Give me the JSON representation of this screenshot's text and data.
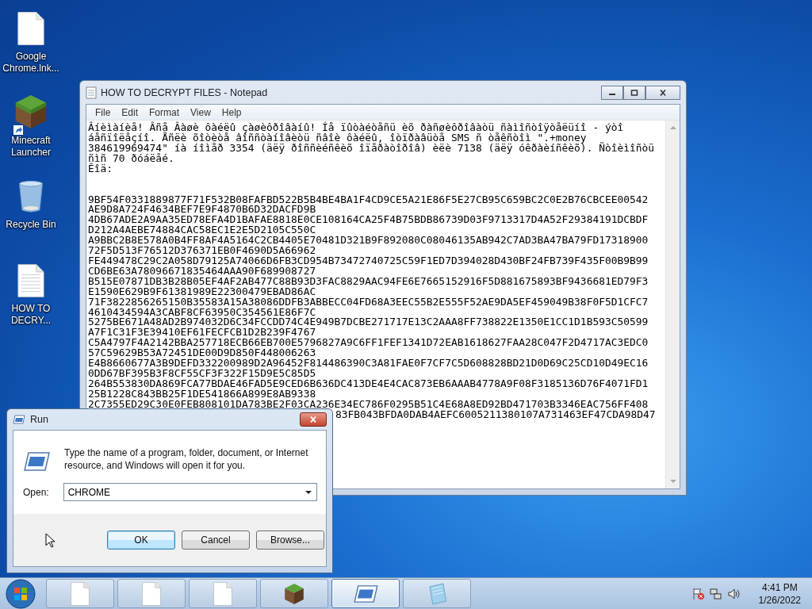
{
  "desktop": {
    "icons": [
      {
        "label": "Google Chrome.lnk...",
        "kind": "document",
        "shortcut": false
      },
      {
        "label": "Minecraft Launcher",
        "kind": "grass-block",
        "shortcut": true
      },
      {
        "label": "Recycle Bin",
        "kind": "recycle-bin",
        "shortcut": false
      },
      {
        "label": "HOW TO DECRY...",
        "kind": "text-document",
        "shortcut": false
      }
    ]
  },
  "notepad": {
    "title": "HOW TO DECRYPT FILES - Notepad",
    "menu": [
      "File",
      "Edit",
      "Format",
      "View",
      "Help"
    ],
    "message_lines": [
      "Âíèìàíèå! Âñå Âàøè ôàéëû çàøèôðîâàíû! Íå ïûòàéòåñü èõ ðàñøèôðîâàòü ñàìîñòîÿòåëüíî - ýòî",
      "áåñïîëåçíî. Åñëè õîòèòå âîññòàíîâèòü ñâîè ôàéëû, îòïðàâüòå SMS ñ òåêñòîì \".+money",
      "384619969474\" íà íîìåð 3354 (äëÿ ðîññèéñêèõ îïåðàòîðîâ) èëè 7138 (äëÿ óêðàèíñêèõ). Ñòîèìîñòü",
      "ñìñ 70 ðóáëåé.",
      "Êîä:"
    ],
    "code_lines": [
      "9BF54F0331889877F71F532B08FAFBD522B5B4BE4BA1F4CD9CE5A21E86F5E27CB95C659BC2C0E2B76CBCEE00542",
      "AE9D8A724F4634BEF7E9F4870B6D32DACFD9B",
      "4DB67ADE2A9AA35ED78EFA4D1BAFAE8818E0CE108164CA25F4B75BDB86739D03F9713317D4A52F29384191DCBDF",
      "D212A4AEBE74884CAC58EC1E2E5D2105C550C",
      "A9BBC2B8E578A0B4FF8AF4A5164C2CB4405E70481D321B9F892080C08046135AB942C7AD3BA47BA79FD17318900",
      "72F5D513F76512D376371EB0F4690D5A66962",
      "FE449478C29C2A058D79125A74066D6FB3CD954B73472740725C59F1ED7D394028D430BF24FB739F435F00B9B99",
      "CD6BE63A78096671835464AAA90F689908727",
      "B515E07871DB3B28B05EF4AF2AB477C88B93D3FAC8829AAC94FE6E7665152916F5D881675893BF9436681ED79F3",
      "E1590E629B9F61381989E22300479EBAD86AC",
      "71F3822856265150B35583A15A38086DDFB3ABBECC04FD68A3EEC55B2E555F52AE9DA5EF459049B38F0F5D1CFC7",
      "4610434594A3CABF8CF63950C354561E86F7C",
      "5275BE671A48AD2B974032D6C34FCCDD74C4E949B7DCBE271717E13C2AAA8FF738822E1350E1CC1D1B593C50599",
      "A7F1C31F3E39410EF61FECFCB1D2B239F4767",
      "C5A4797F4A2142BBA257718ECB66EB700E5796827A9C6FF1FEF1341D72EAB1618627FAA28C047F2D4717AC3EDC0",
      "57C59629B53A72451DE00D9D850F448006263",
      "E4B8660677A3B9DEFD332200989D2A96452F814486390C3A81FAE0F7CF7C5D608828BD21D0D69C25CD10D49EC16",
      "0DD67BF395B3F8CF55CF3F322F15D9E5C85D5",
      "264B553830DA869FCA77BDAE46FAD5E9CED6B636DC413DE4E4CAC873EB6AAAB4778A9F08F3185136D76F4071FD1",
      "25B1228C843BB25F1DE541866A899E8AB9338",
      "2C7355ED29C30E0FEB808101DA783BE2F03CA236E34EC786F0295B51C4E68A8ED92BD471703B3346EAC756FF408"
    ],
    "covered_line": "83FB043BFDA0DAB4AEFC6005211380107A731463EF47CDA98D47"
  },
  "run_dialog": {
    "title": "Run",
    "description": "Type the name of a program, folder, document, or Internet resource, and Windows will open it for you.",
    "open_label": "Open:",
    "value": "CHROME",
    "buttons": [
      {
        "label": "OK",
        "default": true
      },
      {
        "label": "Cancel",
        "default": false
      },
      {
        "label": "Browse...",
        "default": false
      }
    ]
  },
  "taskbar": {
    "buttons": [
      {
        "kind": "document",
        "selected": false
      },
      {
        "kind": "document",
        "selected": false
      },
      {
        "kind": "document",
        "selected": false
      },
      {
        "kind": "grass-block",
        "selected": false
      },
      {
        "kind": "run",
        "selected": true
      },
      {
        "kind": "notepad",
        "selected": false
      }
    ],
    "time": "4:41 PM",
    "date": "1/26/2022"
  }
}
